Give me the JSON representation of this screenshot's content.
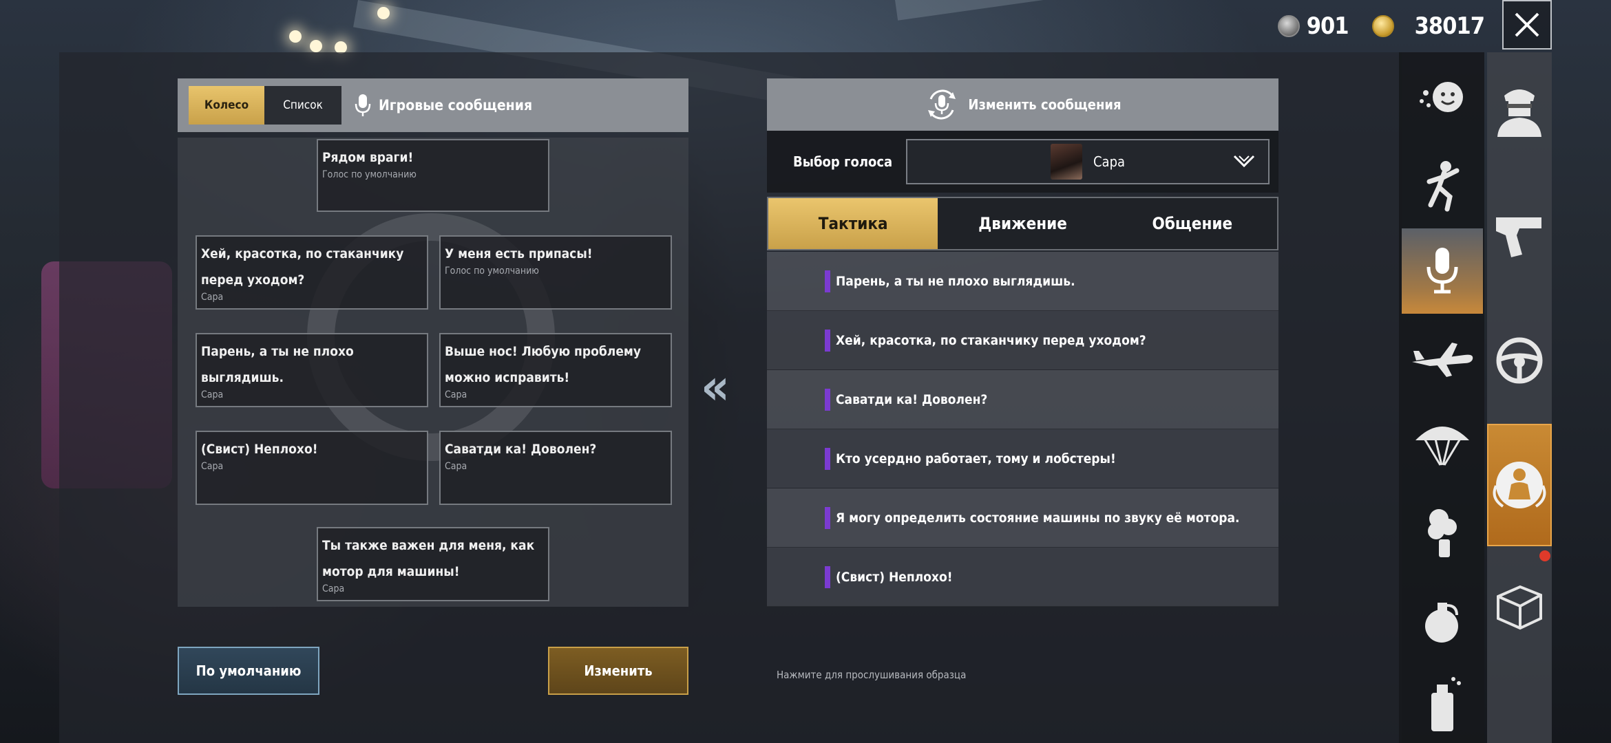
{
  "currency": {
    "silver": "901",
    "gold": "38017"
  },
  "left": {
    "tab_wheel": "Колесо",
    "tab_list": "Список",
    "title": "Игровые сообщения",
    "slots": [
      {
        "msg": "Рядом враги!",
        "sub": "Голос по умолчанию"
      },
      {
        "msg": "Хей, красотка, по стаканчику\nперед уходом?",
        "sub": "Сара"
      },
      {
        "msg": "У меня есть припасы!",
        "sub": "Голос по умолчанию"
      },
      {
        "msg": "Парень, а ты не плохо\nвыглядишь.",
        "sub": "Сара"
      },
      {
        "msg": "Выше нос! Любую проблему\nможно исправить!",
        "sub": "Сара"
      },
      {
        "msg": "(Свист) Неплохо!",
        "sub": "Сара"
      },
      {
        "msg": "Саватди ка! Доволен?",
        "sub": "Сара"
      },
      {
        "msg": "Ты также важен для меня, как\nмотор для машины!",
        "sub": "Сара"
      }
    ],
    "btn_default": "По умолчанию",
    "btn_edit": "Изменить"
  },
  "right": {
    "header": "Изменить сообщения",
    "voice_label": "Выбор голоса",
    "voice_value": "Сара",
    "tabs": [
      "Тактика",
      "Движение",
      "Общение"
    ],
    "messages": [
      "Парень, а ты не плохо выглядишь.",
      "Хей, красотка, по стаканчику перед уходом?",
      "Саватди ка! Доволен?",
      "Кто усердно работает, тому и лобстеры!",
      "Я могу определить состояние машины по звуку её мотора.",
      "(Свист) Неплохо!"
    ],
    "hint": "Нажмите для прослушивания образца"
  },
  "colors": {
    "accent_gold": "#c9a14a",
    "accent_purple": "#7b3bd1",
    "active_orange": "#c98a34"
  }
}
